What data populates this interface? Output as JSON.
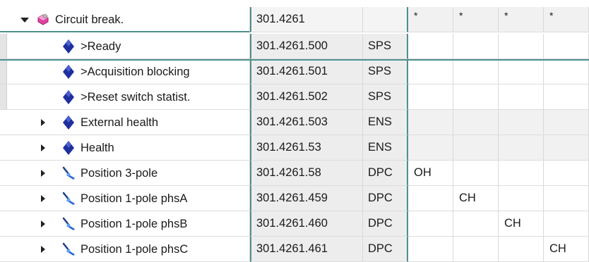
{
  "header": {
    "name": "Circuit break.",
    "address": "301.4261",
    "type": "",
    "columns": [
      "*",
      "*",
      "*",
      "*"
    ]
  },
  "rows": [
    {
      "name": ">Ready",
      "address": "301.4261.500",
      "type": "SPS",
      "icon": "diamond-icon",
      "expandable": false,
      "values": [
        "",
        "",
        "",
        ""
      ]
    },
    {
      "name": ">Acquisition blocking",
      "address": "301.4261.501",
      "type": "SPS",
      "icon": "diamond-icon",
      "expandable": false,
      "values": [
        "",
        "",
        "",
        ""
      ]
    },
    {
      "name": ">Reset switch statist.",
      "address": "301.4261.502",
      "type": "SPS",
      "icon": "diamond-icon",
      "expandable": false,
      "values": [
        "",
        "",
        "",
        ""
      ]
    },
    {
      "name": "External health",
      "address": "301.4261.503",
      "type": "ENS",
      "icon": "diamond-icon",
      "expandable": true,
      "values": [
        "",
        "",
        "",
        ""
      ]
    },
    {
      "name": "Health",
      "address": "301.4261.53",
      "type": "ENS",
      "icon": "diamond-icon",
      "expandable": true,
      "values": [
        "",
        "",
        "",
        ""
      ]
    },
    {
      "name": "Position 3-pole",
      "address": "301.4261.58",
      "type": "DPC",
      "icon": "switch-icon",
      "expandable": true,
      "values": [
        "OH",
        "",
        "",
        ""
      ]
    },
    {
      "name": "Position 1-pole phsA",
      "address": "301.4261.459",
      "type": "DPC",
      "icon": "switch-icon",
      "expandable": true,
      "values": [
        "",
        "CH",
        "",
        ""
      ]
    },
    {
      "name": "Position 1-pole phsB",
      "address": "301.4261.460",
      "type": "DPC",
      "icon": "switch-icon",
      "expandable": true,
      "values": [
        "",
        "",
        "CH",
        ""
      ]
    },
    {
      "name": "Position 1-pole phsC",
      "address": "301.4261.461",
      "type": "DPC",
      "icon": "switch-icon",
      "expandable": true,
      "values": [
        "",
        "",
        "",
        "CH"
      ]
    }
  ],
  "colors": {
    "accent_line": "#4f8f8c",
    "diamond": "#1f2f9e",
    "function_block": "#e040a0"
  }
}
